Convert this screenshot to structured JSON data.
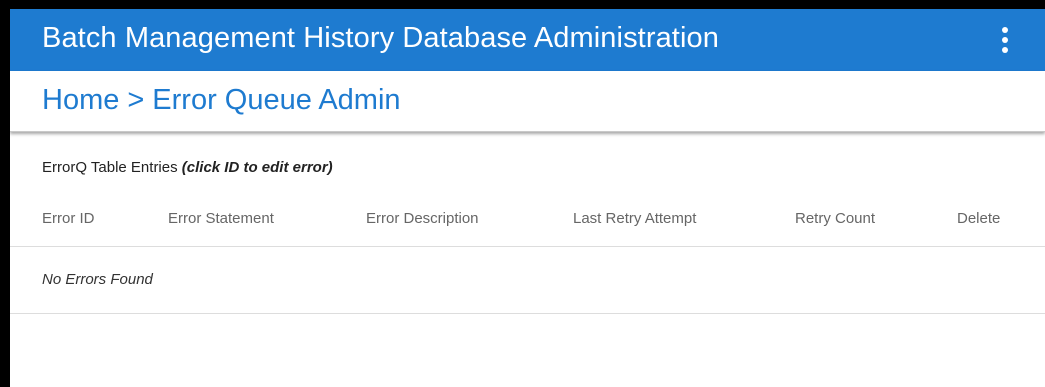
{
  "header": {
    "title": "Batch Management History Database Administration",
    "menu_icon": "more-vert-icon"
  },
  "breadcrumb": {
    "home": "Home",
    "separator": ">",
    "current": "Error Queue Admin"
  },
  "section": {
    "title": "ErrorQ Table Entries",
    "hint": "(click ID to edit error)"
  },
  "table": {
    "columns": [
      "Error ID",
      "Error Statement",
      "Error Description",
      "Last Retry Attempt",
      "Retry Count",
      "Delete"
    ],
    "empty_message": "No Errors Found"
  },
  "colors": {
    "primary": "#1e7bd0",
    "header_text": "#ffffff"
  }
}
